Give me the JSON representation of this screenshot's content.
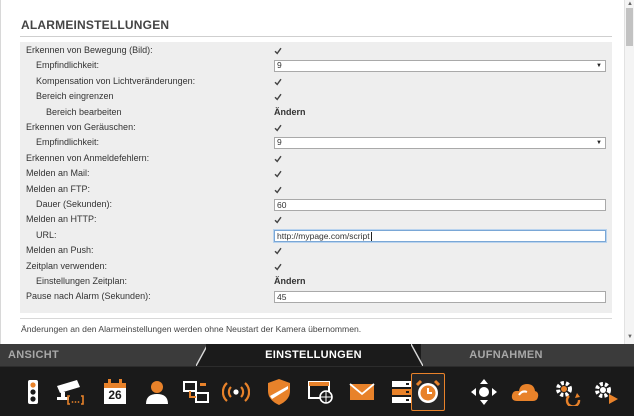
{
  "panel": {
    "title": "ALARMEINSTELLUNGEN",
    "note": "Änderungen an den Alarmeinstellungen werden ohne Neustart der Kamera übernommen."
  },
  "settings": [
    {
      "label": "Erkennen von Bewegung (Bild):",
      "indent": 0,
      "control": "checkbox",
      "checked": true
    },
    {
      "label": "Empfindlichkeit:",
      "indent": 1,
      "control": "select",
      "value": "9"
    },
    {
      "label": "Kompensation von Lichtveränderungen:",
      "indent": 1,
      "control": "checkbox",
      "checked": true
    },
    {
      "label": "Bereich eingrenzen",
      "indent": 1,
      "control": "checkbox",
      "checked": true
    },
    {
      "label": "Bereich bearbeiten",
      "indent": 2,
      "control": "link",
      "value": "Ändern"
    },
    {
      "label": "Erkennen von Geräuschen:",
      "indent": 0,
      "control": "checkbox",
      "checked": true
    },
    {
      "label": "Empfindlichkeit:",
      "indent": 1,
      "control": "select",
      "value": "9"
    },
    {
      "label": "Erkennen von Anmeldefehlern:",
      "indent": 0,
      "control": "checkbox",
      "checked": true
    },
    {
      "label": "Melden an Mail:",
      "indent": 0,
      "control": "checkbox",
      "checked": true
    },
    {
      "label": "Melden an FTP:",
      "indent": 0,
      "control": "checkbox",
      "checked": true
    },
    {
      "label": "Dauer (Sekunden):",
      "indent": 1,
      "control": "input",
      "value": "60"
    },
    {
      "label": "Melden an HTTP:",
      "indent": 0,
      "control": "checkbox",
      "checked": true
    },
    {
      "label": "URL:",
      "indent": 1,
      "control": "input",
      "value": "http://mypage.com/script",
      "focused": true
    },
    {
      "label": "Melden an Push:",
      "indent": 0,
      "control": "checkbox",
      "checked": true
    },
    {
      "label": "Zeitplan verwenden:",
      "indent": 0,
      "control": "checkbox",
      "checked": true
    },
    {
      "label": "Einstellungen Zeitplan:",
      "indent": 1,
      "control": "link",
      "value": "Ändern"
    },
    {
      "label": "Pause nach Alarm (Sekunden):",
      "indent": 0,
      "control": "input",
      "value": "45"
    }
  ],
  "tabs": [
    {
      "label": "ANSICHT",
      "active": false
    },
    {
      "label": "EINSTELLUNGEN",
      "active": true
    },
    {
      "label": "AUFNAHMEN",
      "active": false
    }
  ],
  "toolbar": {
    "items": [
      {
        "icon": "traffic-light-icon",
        "active": false
      },
      {
        "icon": "camera-recording-icon",
        "active": false
      },
      {
        "icon": "calendar-icon",
        "calendar_day": "26",
        "active": false
      },
      {
        "icon": "user-icon",
        "active": false
      },
      {
        "icon": "network-devices-icon",
        "active": false
      },
      {
        "icon": "wireless-icon",
        "active": false
      },
      {
        "icon": "shield-icon",
        "active": false
      },
      {
        "icon": "web-browser-icon",
        "active": false
      },
      {
        "icon": "mail-icon",
        "active": false
      },
      {
        "icon": "server-icon",
        "active": false
      },
      {
        "icon": "alarm-clock-icon",
        "active": true
      },
      {
        "icon": "pan-tilt-icon",
        "active": false
      },
      {
        "icon": "cloud-icon",
        "active": false
      },
      {
        "icon": "gear-sync-icon",
        "active": false
      },
      {
        "icon": "gear-play-icon",
        "active": false
      }
    ]
  },
  "colors": {
    "accent": "#e8822a",
    "tab_bar": "#3b3b3b",
    "toolbar": "#1a1a1a",
    "form_background": "#eeeeee"
  }
}
